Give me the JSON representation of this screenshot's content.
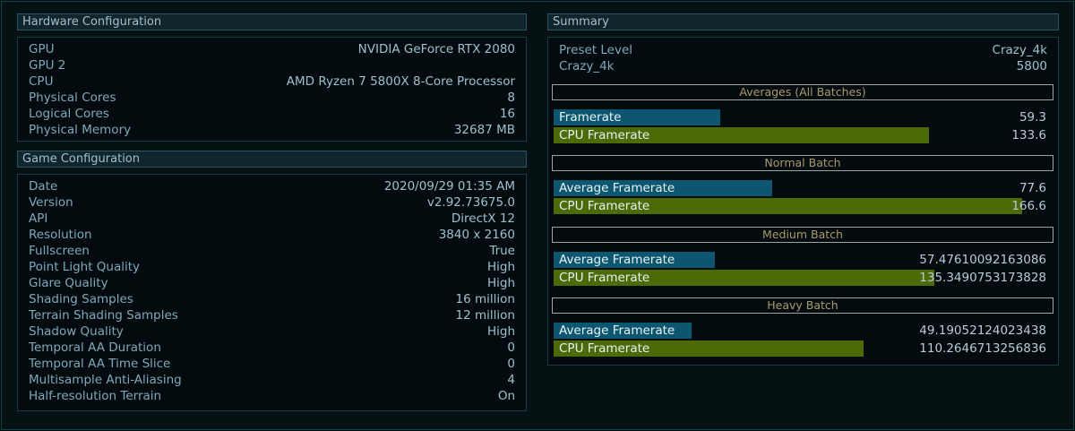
{
  "hardware": {
    "title": "Hardware Configuration",
    "rows": [
      {
        "label": "GPU",
        "value": "NVIDIA GeForce RTX 2080"
      },
      {
        "label": "GPU 2",
        "value": ""
      },
      {
        "label": "CPU",
        "value": "AMD Ryzen 7 5800X 8-Core Processor"
      },
      {
        "label": "Physical Cores",
        "value": "8"
      },
      {
        "label": "Logical Cores",
        "value": "16"
      },
      {
        "label": "Physical Memory",
        "value": "32687 MB"
      }
    ]
  },
  "game": {
    "title": "Game Configuration",
    "rows": [
      {
        "label": "Date",
        "value": "2020/09/29 01:35 AM"
      },
      {
        "label": "Version",
        "value": "v2.92.73675.0"
      },
      {
        "label": "API",
        "value": "DirectX 12"
      },
      {
        "label": "Resolution",
        "value": "3840 x 2160"
      },
      {
        "label": "Fullscreen",
        "value": "True"
      },
      {
        "label": "Point Light Quality",
        "value": "High"
      },
      {
        "label": "Glare Quality",
        "value": "High"
      },
      {
        "label": "Shading Samples",
        "value": "16 million"
      },
      {
        "label": "Terrain Shading Samples",
        "value": "12 million"
      },
      {
        "label": "Shadow Quality",
        "value": "High"
      },
      {
        "label": "Temporal AA Duration",
        "value": "0"
      },
      {
        "label": "Temporal AA Time Slice",
        "value": "0"
      },
      {
        "label": "Multisample Anti-Aliasing",
        "value": "4"
      },
      {
        "label": "Half-resolution Terrain",
        "value": "On"
      }
    ]
  },
  "summary": {
    "title": "Summary",
    "rows": [
      {
        "label": "Preset Level",
        "value": "Crazy_4k"
      },
      {
        "label": "Crazy_4k",
        "value": "5800"
      }
    ],
    "bar_scale_max": 166.6,
    "sections": [
      {
        "title": "Averages (All Batches)",
        "bars": [
          {
            "label": "Framerate",
            "value": "59.3",
            "num": 59.3,
            "kind": "fr"
          },
          {
            "label": "CPU Framerate",
            "value": "133.6",
            "num": 133.6,
            "kind": "cpu"
          }
        ]
      },
      {
        "title": "Normal Batch",
        "bars": [
          {
            "label": "Average Framerate",
            "value": "77.6",
            "num": 77.6,
            "kind": "fr"
          },
          {
            "label": "CPU Framerate",
            "value": "166.6",
            "num": 166.6,
            "kind": "cpu"
          }
        ]
      },
      {
        "title": "Medium Batch",
        "bars": [
          {
            "label": "Average Framerate",
            "value": "57.47610092163086",
            "num": 57.47610092163086,
            "kind": "fr"
          },
          {
            "label": "CPU Framerate",
            "value": "135.3490753173828",
            "num": 135.3490753173828,
            "kind": "cpu"
          }
        ]
      },
      {
        "title": "Heavy Batch",
        "bars": [
          {
            "label": "Average Framerate",
            "value": "49.19052124023438",
            "num": 49.19052124023438,
            "kind": "fr"
          },
          {
            "label": "CPU Framerate",
            "value": "110.2646713256836",
            "num": 110.2646713256836,
            "kind": "cpu"
          }
        ]
      }
    ]
  },
  "colors": {
    "framerate_bar": "#0c5670",
    "cpu_bar": "#4c6a06",
    "background": "#030a0c"
  }
}
